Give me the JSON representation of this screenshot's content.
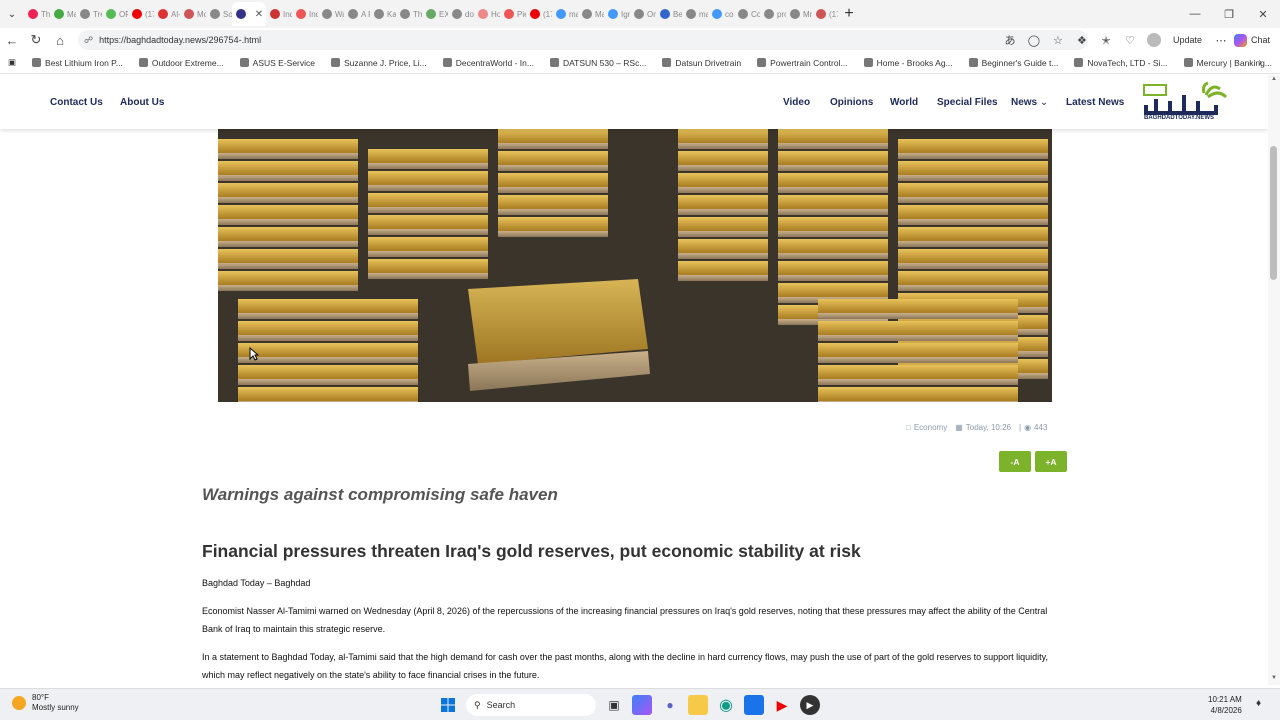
{
  "browser": {
    "tabs": [
      "The",
      "Ma",
      "Tre",
      "OFI",
      "(174",
      "Al-K",
      "Mo",
      "Sou",
      "",
      "Indi",
      "Inde",
      "Wa",
      "A P",
      "Kan",
      "The",
      "EXC",
      "dov",
      "Hor",
      "Pier",
      "(170",
      "ma",
      "Ma",
      "Igni",
      "Orp",
      "Bes",
      "mar",
      "con",
      "Cor",
      "pro",
      "Mr.",
      "(17"
    ],
    "active_tab_index": 8,
    "url": "https://baghdadtoday.news/296754-.html",
    "update_label": "Update",
    "chat_label": "Chat",
    "bookmarks": [
      "Best Lithium Iron P...",
      "Outdoor Extreme...",
      "ASUS E-Service",
      "Suzanne J. Price, Li...",
      "DecentraWorld - In...",
      "DATSUN 530 – RSc...",
      "Datsun Drivetrain",
      "Powertrain Control...",
      "Home - Brooks Ag...",
      "Beginner's Guide t...",
      "NovaTech, LTD - Si...",
      "Mercury | Banking..."
    ]
  },
  "site": {
    "nav_left": [
      "Contact Us",
      "About Us"
    ],
    "nav_right": [
      "Video",
      "Opinions",
      "World",
      "Special Files",
      "News",
      "Latest News"
    ],
    "logo_arabic": "بغداد اليوم",
    "logo_latin": "BAGHDADTODAY.NEWS",
    "brand_colors": {
      "navy": "#1e2a5a",
      "green": "#7cb32a"
    }
  },
  "article": {
    "category": "Economy",
    "time": "Today, 10:26",
    "views": "443",
    "font_minus": "-A",
    "font_plus": "+A",
    "subtitle": "Warnings against compromising safe haven",
    "headline": "Financial pressures threaten Iraq's gold reserves, put economic stability at risk",
    "byline": "Baghdad Today – Baghdad",
    "paragraphs": [
      "Economist Nasser Al-Tamimi warned on Wednesday (April 8, 2026) of the repercussions of the increasing financial pressures on Iraq's gold reserves, noting that these pressures may affect the ability of the Central Bank of Iraq to maintain this strategic reserve.",
      "In a statement to Baghdad Today, al-Tamimi said that the high demand for cash over the past months, along with the decline in hard currency flows, may push the use of part of the gold reserves to support liquidity, which may reflect negatively on the state's ability to face financial crises in the future."
    ]
  },
  "taskbar": {
    "temperature": "80°F",
    "condition": "Mostly sunny",
    "search_label": "Search",
    "time": "10:21 AM",
    "date": "4/8/2026"
  }
}
